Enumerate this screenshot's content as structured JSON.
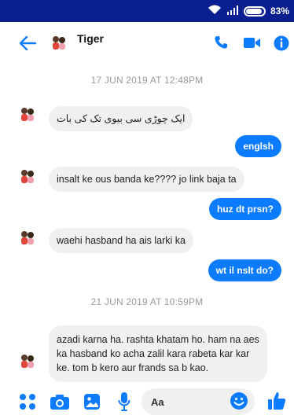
{
  "status_bar": {
    "battery_percent": "83%"
  },
  "header": {
    "contact_name": "Tiger"
  },
  "dates": [
    "17 JUN 2019 AT 12:48PM",
    "21 JUN 2019 AT 10:59PM"
  ],
  "messages": {
    "m1": "ایک چوڑی سی بیوی تک کی بات",
    "m2": "englsh",
    "m3": "insalt ke ous banda ke???? jo link baja ta",
    "m4": "huz dt prsn?",
    "m5": "waehi hasband ha ais larki ka",
    "m6": "wt il nslt do?",
    "m7": "azadi karna ha. rashta khatam ho. ham na aes ka hasband ko acha zalil kara rabeta kar kar ke. tom b kero aur frands sa b kao."
  },
  "composer": {
    "placeholder": "Aa"
  },
  "colors": {
    "accent": "#0b7cff",
    "status_bar": "#0a1f8f"
  }
}
